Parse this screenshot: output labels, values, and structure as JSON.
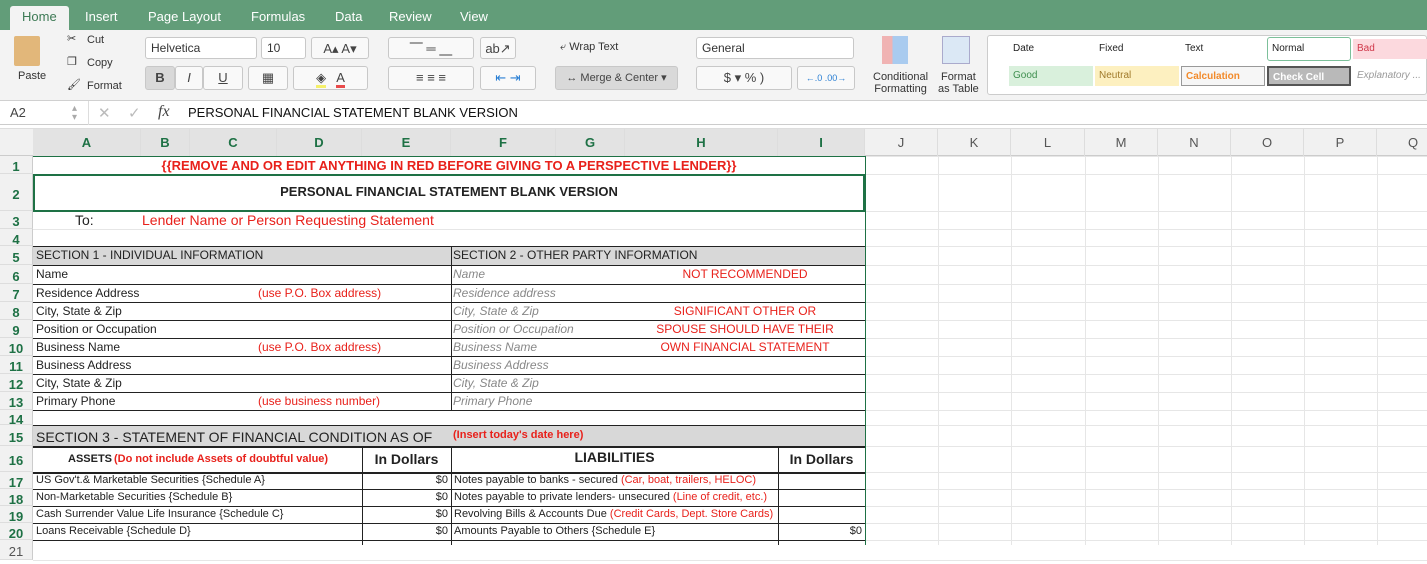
{
  "tabs": [
    "Home",
    "Insert",
    "Page Layout",
    "Formulas",
    "Data",
    "Review",
    "View"
  ],
  "ribbon": {
    "paste": "Paste",
    "cut": "Cut",
    "copy": "Copy",
    "format": "Format",
    "font": "Helvetica",
    "size": "10",
    "bold": "B",
    "italic": "I",
    "underline": "U",
    "wrap_text": "Wrap Text",
    "merge_center": "Merge & Center",
    "number_format": "General",
    "currency": "$",
    "percent": "%",
    "comma": ")",
    "cond_fmt_1": "Conditional",
    "cond_fmt_2": "Formatting",
    "fmt_table_1": "Format",
    "fmt_table_2": "as Table",
    "styles": [
      "Date",
      "Fixed",
      "Text",
      "Normal",
      "Bad",
      "Good",
      "Neutral",
      "Calculation",
      "Check Cell",
      "Explanatory ..."
    ]
  },
  "formula_bar": {
    "cell_ref": "A2",
    "fx": "fx",
    "value": "PERSONAL FINANCIAL STATEMENT BLANK VERSION"
  },
  "columns": [
    "A",
    "B",
    "C",
    "D",
    "E",
    "F",
    "G",
    "H",
    "I",
    "J",
    "K",
    "L",
    "M",
    "N",
    "O",
    "P",
    "Q"
  ],
  "rows": [
    "1",
    "2",
    "3",
    "4",
    "5",
    "6",
    "7",
    "8",
    "9",
    "10",
    "11",
    "12",
    "13",
    "14",
    "15",
    "16",
    "17",
    "18",
    "19",
    "20",
    "21"
  ],
  "sheet": {
    "r1": "{{REMOVE AND OR EDIT ANYTHING IN RED BEFORE GIVING TO A PERSPECTIVE LENDER}}",
    "r2": "PERSONAL FINANCIAL STATEMENT BLANK VERSION",
    "to": "To:",
    "lender": "Lender Name or Person Requesting Statement",
    "sec1": "SECTION 1 - INDIVIDUAL INFORMATION",
    "sec2": "SECTION 2 - OTHER PARTY INFORMATION",
    "s1": [
      "Name",
      "Residence Address",
      "City, State & Zip",
      "Position or Occupation",
      "Business Name",
      "Business Address",
      "City, State & Zip",
      "Primary Phone"
    ],
    "s1notes": [
      "",
      "(use P.O. Box address)",
      "",
      "",
      "(use P.O. Box address)",
      "",
      "",
      "(use business number)"
    ],
    "s2": [
      "Name",
      "Residence address",
      "City, State & Zip",
      "Position or Occupation",
      "Business Name",
      "Business Address",
      "City, State & Zip",
      "Primary Phone"
    ],
    "s2notes": [
      "NOT RECOMMENDED",
      "",
      "SIGNIFICANT OTHER OR",
      "SPOUSE SHOULD HAVE THEIR",
      "OWN FINANCIAL STATEMENT",
      "",
      "",
      ""
    ],
    "sec3": "SECTION 3 - STATEMENT OF FINANCIAL CONDITION AS OF",
    "sec3note": "(Insert today's date here)",
    "assets": "ASSETS",
    "assets_note": "(Do not include Assets of doubtful value)",
    "in_dollars": "In Dollars",
    "liabilities": "LIABILITIES",
    "asset_rows": [
      "US Gov't.& Marketable Securities {Schedule A}",
      "Non-Marketable Securities {Schedule B}",
      "Cash Surrender Value Life Insurance {Schedule C}",
      "Loans Receivable {Schedule D}"
    ],
    "asset_vals": [
      "$0",
      "$0",
      "$0",
      "$0"
    ],
    "liab_rows": [
      "Notes payable to banks - secured ",
      "Notes payable to private lenders- unsecured ",
      "Revolving Bills & Accounts Due ",
      "Amounts Payable to Others {Schedule E}"
    ],
    "liab_notes": [
      "(Car, boat, trailers, HELOC)",
      "(Line of credit, etc.)",
      "(Credit Cards, Dept. Store Cards)",
      ""
    ],
    "liab_vals": [
      "",
      "",
      "",
      "$0"
    ]
  },
  "colors": {
    "accent": "#629d79",
    "red": "#e8211b",
    "selection": "#1e7145"
  }
}
